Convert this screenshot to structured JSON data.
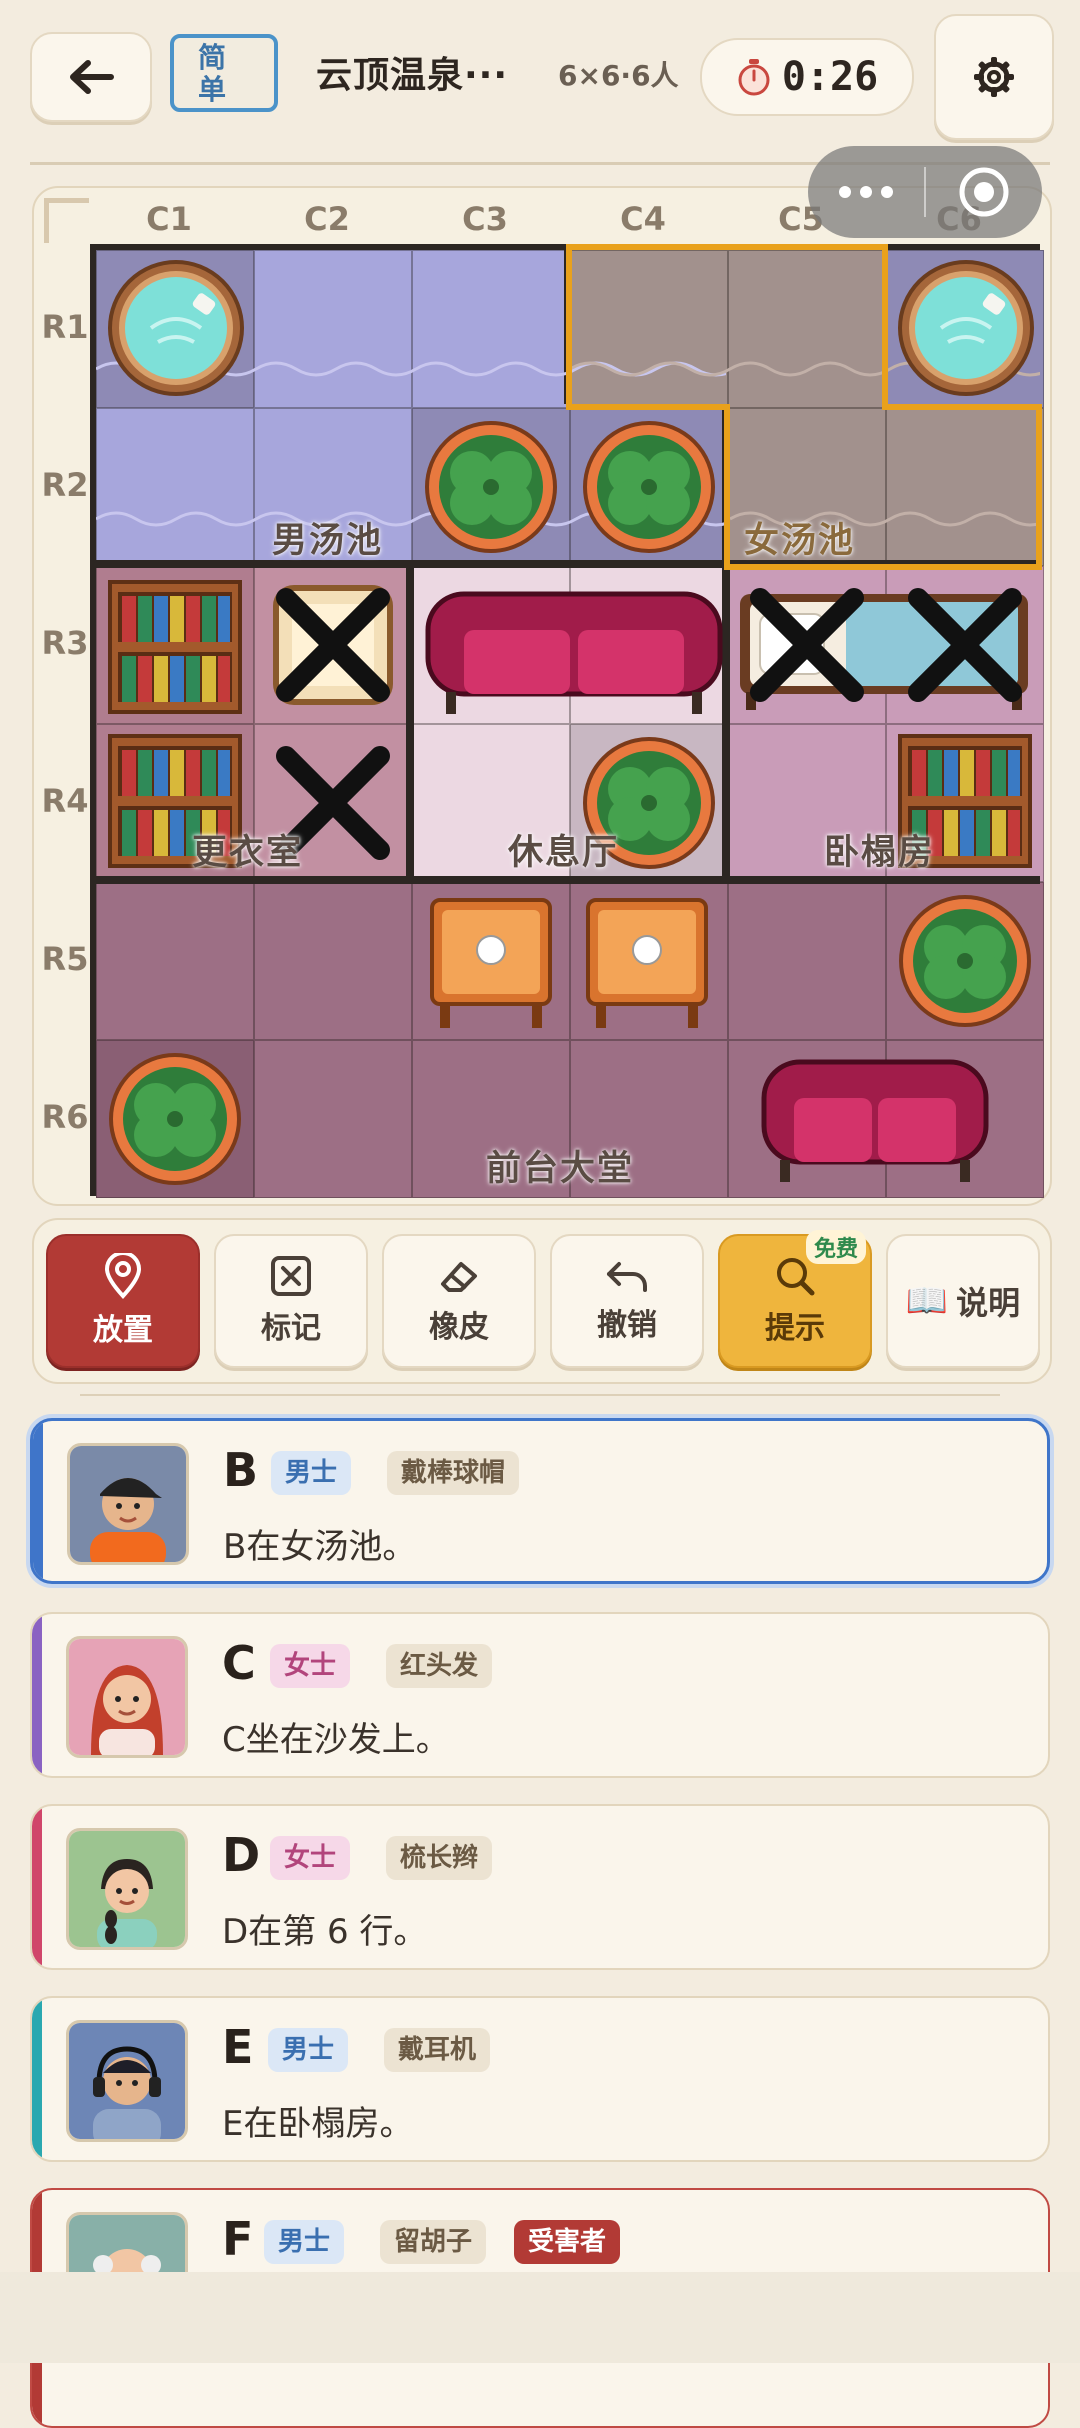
{
  "header": {
    "back_label": "←",
    "difficulty": "简单",
    "title": "云顶温泉···",
    "size_info": "6×6·6人",
    "timer": "0:26"
  },
  "board": {
    "columns": [
      "C1",
      "C2",
      "C3",
      "C4",
      "C5",
      "C6"
    ],
    "rows": [
      "R1",
      "R2",
      "R3",
      "R4",
      "R5",
      "R6"
    ],
    "rooms": [
      {
        "name": "男汤池"
      },
      {
        "name": "女汤池"
      },
      {
        "name": "更衣室"
      },
      {
        "name": "休息厅"
      },
      {
        "name": "卧榻房"
      },
      {
        "name": "前台大堂"
      }
    ]
  },
  "toolbar": {
    "place": "放置",
    "mark": "标记",
    "eraser": "橡皮",
    "undo": "撤销",
    "hint": "提示",
    "hint_badge": "免费",
    "explain": "说明",
    "explain_icon": "📖"
  },
  "suspects": [
    {
      "id": "B",
      "gender": "男士",
      "trait": "戴棒球帽",
      "clue": "B在女汤池。"
    },
    {
      "id": "C",
      "gender": "女士",
      "trait": "红头发",
      "clue": "C坐在沙发上。"
    },
    {
      "id": "D",
      "gender": "女士",
      "trait": "梳长辫",
      "clue": "D在第 6 行。"
    },
    {
      "id": "E",
      "gender": "男士",
      "trait": "戴耳机",
      "clue": "E在卧榻房。"
    },
    {
      "id": "F",
      "gender": "男士",
      "trait": "留胡子",
      "victim": "受害者",
      "clue": ""
    }
  ],
  "colors": {
    "accent_red": "#b23a35",
    "hint_gold": "#efb53d",
    "highlight_orange": "#e9a11b",
    "selected_blue": "#3f75c9"
  }
}
